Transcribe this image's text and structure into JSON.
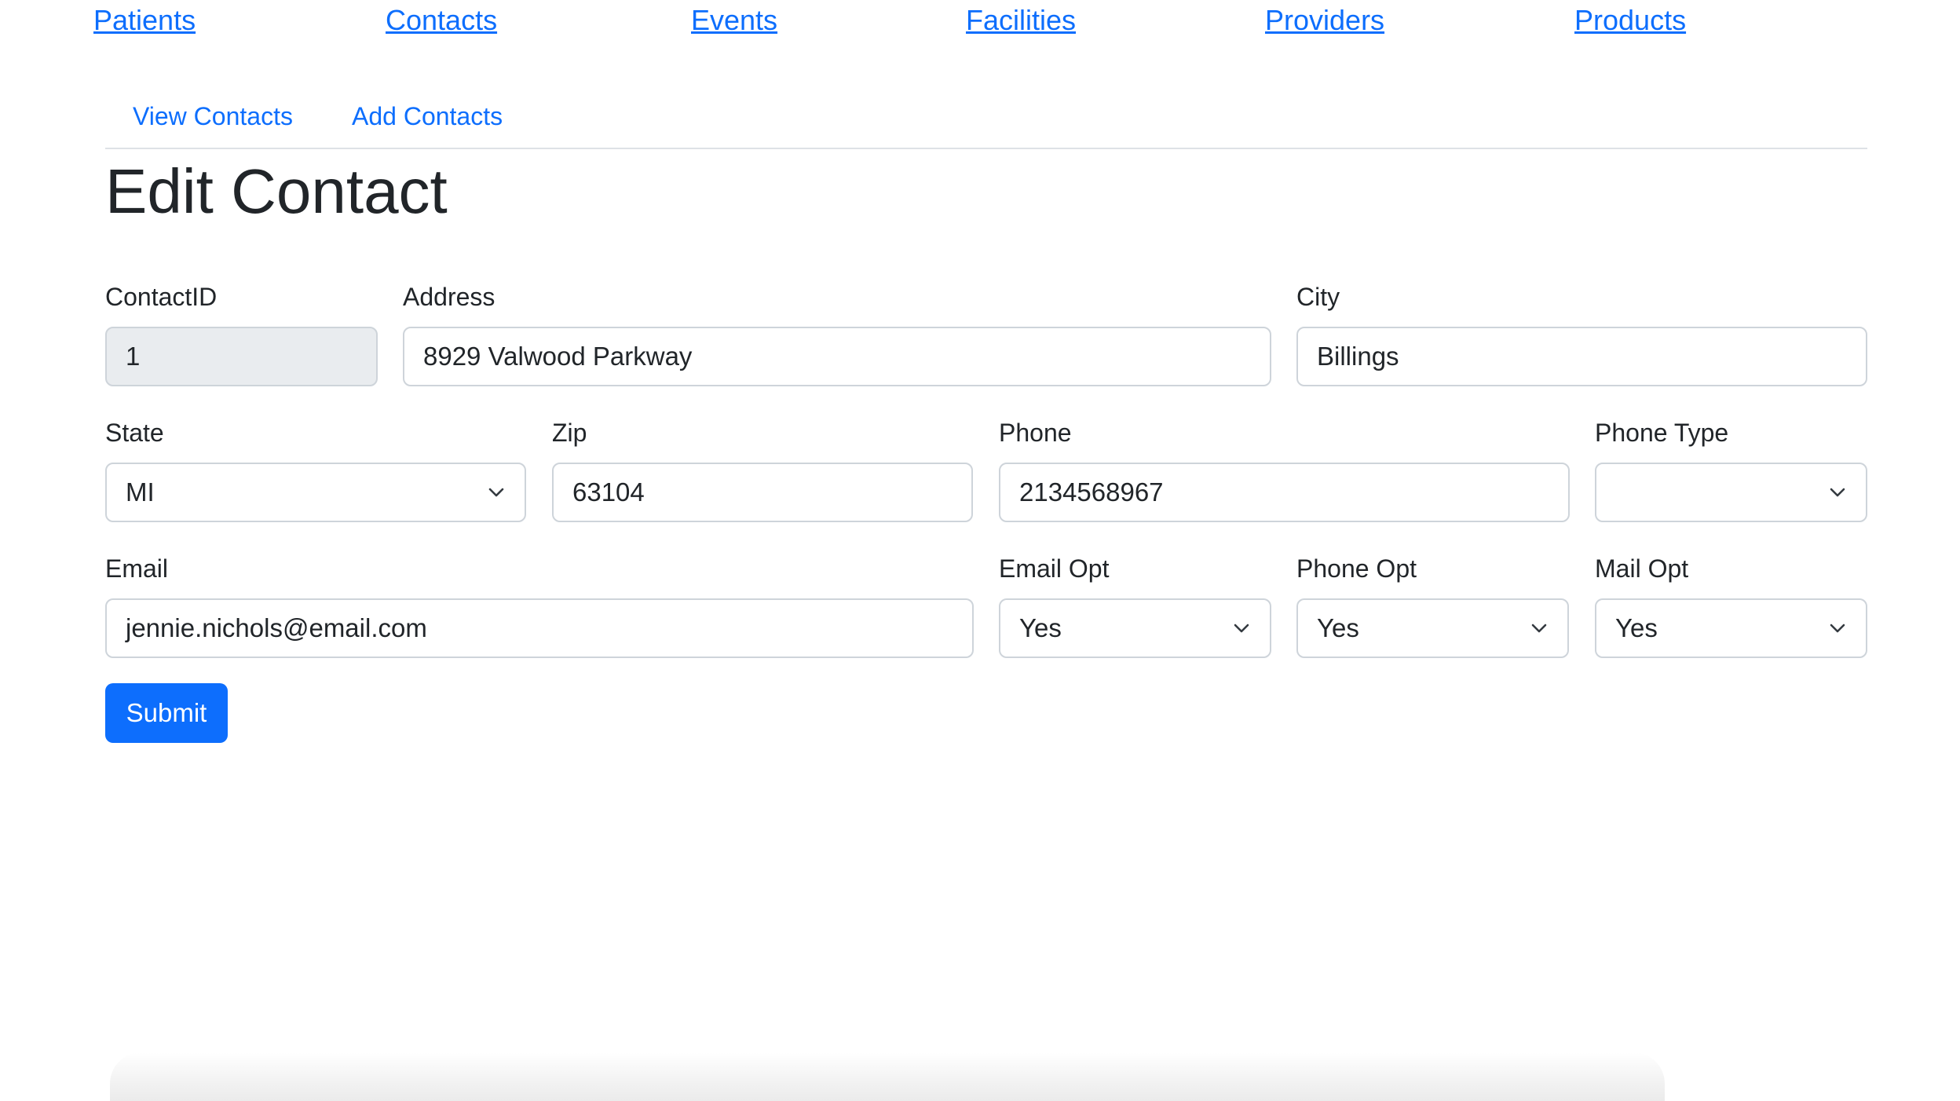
{
  "nav": {
    "patients": "Patients",
    "contacts": "Contacts",
    "events": "Events",
    "facilities": "Facilities",
    "providers": "Providers",
    "products": "Products"
  },
  "subnav": {
    "view": "View Contacts",
    "add": "Add Contacts"
  },
  "page_title": "Edit Contact",
  "form": {
    "contact_id": {
      "label": "ContactID",
      "value": "1"
    },
    "address": {
      "label": "Address",
      "value": "8929 Valwood Parkway"
    },
    "city": {
      "label": "City",
      "value": "Billings"
    },
    "state": {
      "label": "State",
      "value": "MI"
    },
    "zip": {
      "label": "Zip",
      "value": "63104"
    },
    "phone": {
      "label": "Phone",
      "value": "2134568967"
    },
    "phone_type": {
      "label": "Phone Type",
      "value": ""
    },
    "email": {
      "label": "Email",
      "value": "jennie.nichols@email.com"
    },
    "email_opt": {
      "label": "Email Opt",
      "value": "Yes"
    },
    "phone_opt": {
      "label": "Phone Opt",
      "value": "Yes"
    },
    "mail_opt": {
      "label": "Mail Opt",
      "value": "Yes"
    },
    "submit": "Submit"
  },
  "colors": {
    "link": "#0d6efd",
    "primary_button": "#0d6efd",
    "disabled_field": "#e9ecef",
    "border": "#ced4da"
  },
  "icons": {
    "select_arrow": "chevron-down-icon"
  }
}
